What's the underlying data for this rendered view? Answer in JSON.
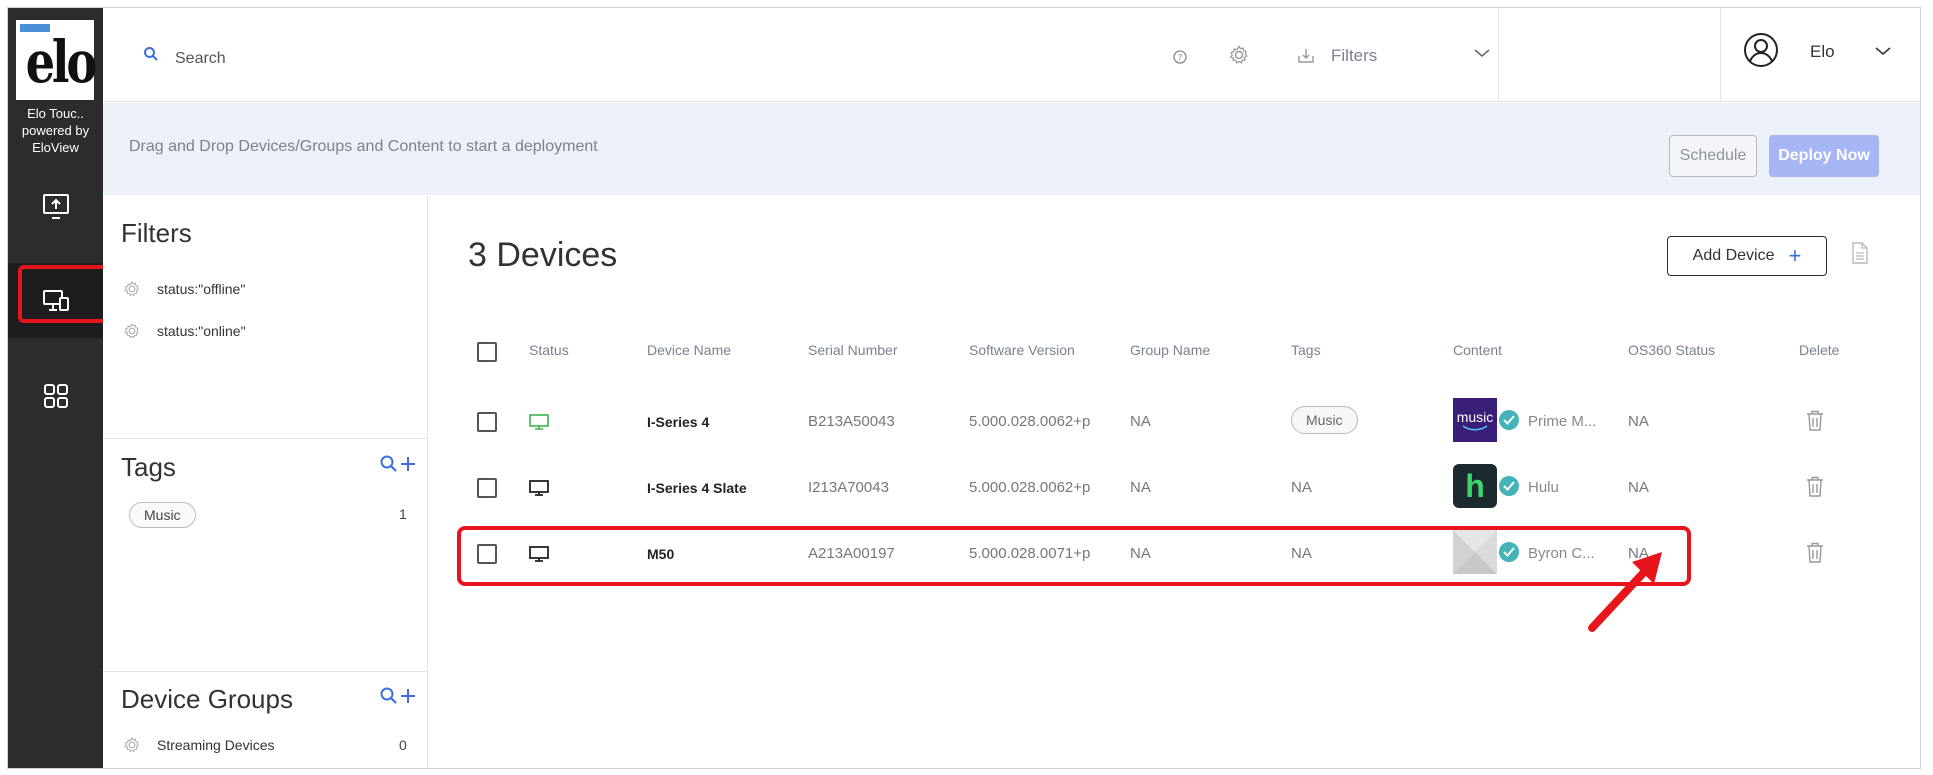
{
  "app": {
    "brand_name": "Elo Touc..\npowered by\nEloView",
    "logo_text": "elo"
  },
  "topbar": {
    "search_placeholder": "Search",
    "filters_label": "Filters",
    "user_name": "Elo"
  },
  "banner": {
    "text": "Drag and Drop Devices/Groups and Content to start a deployment",
    "schedule_label": "Schedule",
    "deploy_label": "Deploy Now"
  },
  "side": {
    "filters_title": "Filters",
    "filters": [
      "status:\"offline\"",
      "status:\"online\""
    ],
    "tags_title": "Tags",
    "tags": [
      {
        "label": "Music",
        "count": "1"
      }
    ],
    "groups_title": "Device Groups",
    "groups": [
      {
        "label": "Streaming Devices",
        "count": "0"
      }
    ]
  },
  "main": {
    "title": "3 Devices",
    "add_device_label": "Add Device",
    "columns": [
      "Status",
      "Device Name",
      "Serial Number",
      "Software Version",
      "Group Name",
      "Tags",
      "Content",
      "OS360 Status",
      "Delete"
    ],
    "rows": [
      {
        "status": "online",
        "name": "I-Series 4",
        "serial": "B213A50043",
        "software": "5.000.028.0062+p",
        "group": "NA",
        "tags": "Music",
        "content_thumb": "music",
        "content": "Prime M...",
        "os360": "NA"
      },
      {
        "status": "offline",
        "name": "I-Series 4 Slate",
        "serial": "I213A70043",
        "software": "5.000.028.0062+p",
        "group": "NA",
        "tags": "NA",
        "content_thumb": "h",
        "content": "Hulu",
        "os360": "NA"
      },
      {
        "status": "offline",
        "name": "M50",
        "serial": "A213A00197",
        "software": "5.000.028.0071+p",
        "group": "NA",
        "tags": "NA",
        "content_thumb": "",
        "content": "Byron C...",
        "os360": "NA"
      }
    ]
  },
  "colors": {
    "rail_bg": "#2c2c2e",
    "accent_blue": "#3b6fe0",
    "deploy_btn": "#a8b5f5",
    "online_green": "#3bb54a",
    "check_teal": "#45b3b8",
    "highlight_red": "#e8141c"
  }
}
